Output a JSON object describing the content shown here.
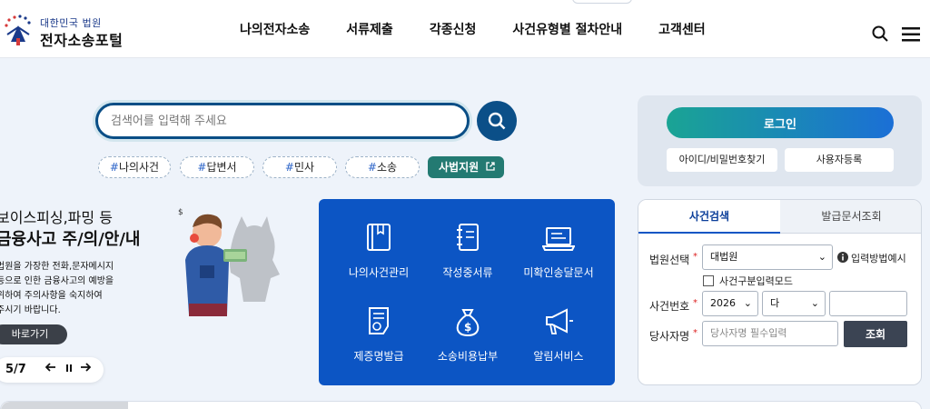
{
  "header": {
    "logo_sub": "대한민국 법원",
    "logo_main": "전자소송포털",
    "nav": [
      "나의전자소송",
      "서류제출",
      "각종신청",
      "사건유형별 절차안내",
      "고객센터"
    ]
  },
  "search": {
    "placeholder": "검색어를 입력해 주세요",
    "tags": [
      "나의사건",
      "답변서",
      "민사",
      "소송"
    ],
    "special_tag": "사법지원"
  },
  "banner": {
    "title_line1": "보이스피싱,파밍 등",
    "title_line2": "금융사고 주/의/안/내",
    "desc": [
      "법원을 가장한 전화,문자메시지",
      "등으로 인한 금융사고의 예방을",
      "위하여 주의사항을 숙지하여",
      "주시기 바랍니다."
    ],
    "go_button": "바로가기",
    "page_current": "5",
    "page_total": "7"
  },
  "quick_menu": [
    {
      "label": "나의사건관리",
      "icon": "book-icon"
    },
    {
      "label": "작성중서류",
      "icon": "notebook-icon"
    },
    {
      "label": "미확인송달문서",
      "icon": "laptop-icon"
    },
    {
      "label": "제증명발급",
      "icon": "certificate-icon"
    },
    {
      "label": "소송비용납부",
      "icon": "money-bag-icon"
    },
    {
      "label": "알림서비스",
      "icon": "megaphone-icon"
    }
  ],
  "login": {
    "login_button": "로그인",
    "find_button": "아이디/비밀번호찾기",
    "register_button": "사용자등록"
  },
  "case_search": {
    "tab_active": "사건검색",
    "tab_inactive": "발급문서조회",
    "court_label": "법원선택",
    "court_value": "대법원",
    "help_link": "입력방법예시",
    "mode_checkbox": "사건구분입력모드",
    "case_no_label": "사건번호",
    "year_value": "2026",
    "type_value": "다",
    "party_label": "당사자명",
    "party_placeholder": "당사자명 필수입력",
    "search_button": "조회"
  },
  "colors": {
    "primary_blue": "#0c55c4",
    "search_navy": "#0b4f88",
    "teal": "#237a72",
    "dark_button": "#3b4453"
  }
}
